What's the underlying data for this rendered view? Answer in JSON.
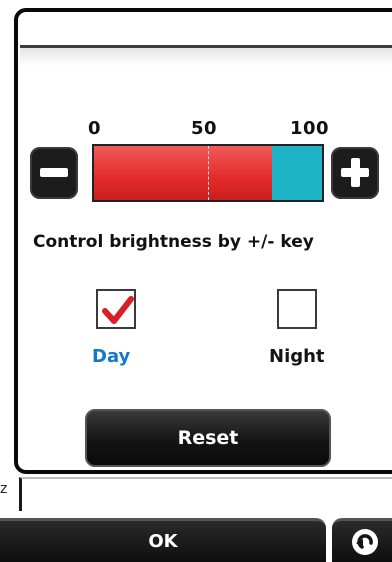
{
  "scale": {
    "min_label": "0",
    "mid_label": "50",
    "max_label": "100"
  },
  "brightness": {
    "level_percent": 78
  },
  "instruction_text": "Control brightness by +/- key",
  "modes": {
    "day": {
      "label": "Day",
      "checked": true
    },
    "night": {
      "label": "Night",
      "checked": false
    }
  },
  "reset_label": "Reset",
  "side_text": "z",
  "ok_label": "OK",
  "colors": {
    "fill": "#e32a2a",
    "remaining": "#1fb3c6",
    "day_label": "#1577c8",
    "check": "#d8202a"
  },
  "icons": {
    "minus": "minus-icon",
    "plus": "plus-icon",
    "check": "checkmark-icon",
    "back": "back-arrow-icon"
  }
}
